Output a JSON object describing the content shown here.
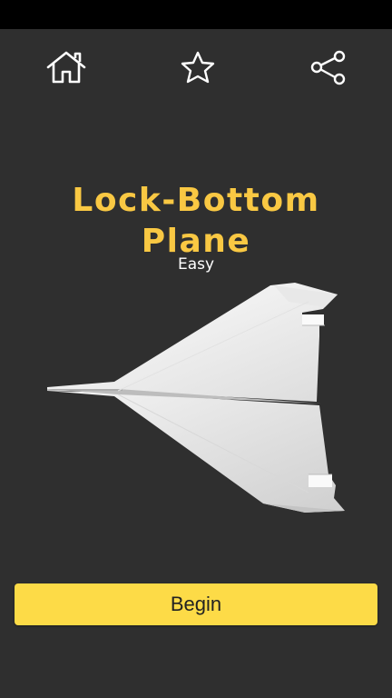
{
  "header": {
    "home_icon": "home-icon",
    "favorite_icon": "star-icon",
    "share_icon": "share-icon"
  },
  "plane": {
    "name": "Lock-Bottom Plane",
    "difficulty": "Easy"
  },
  "actions": {
    "begin_label": "Begin"
  },
  "colors": {
    "background": "#2f2f2f",
    "title": "#f9c843",
    "button": "#fddb47"
  }
}
